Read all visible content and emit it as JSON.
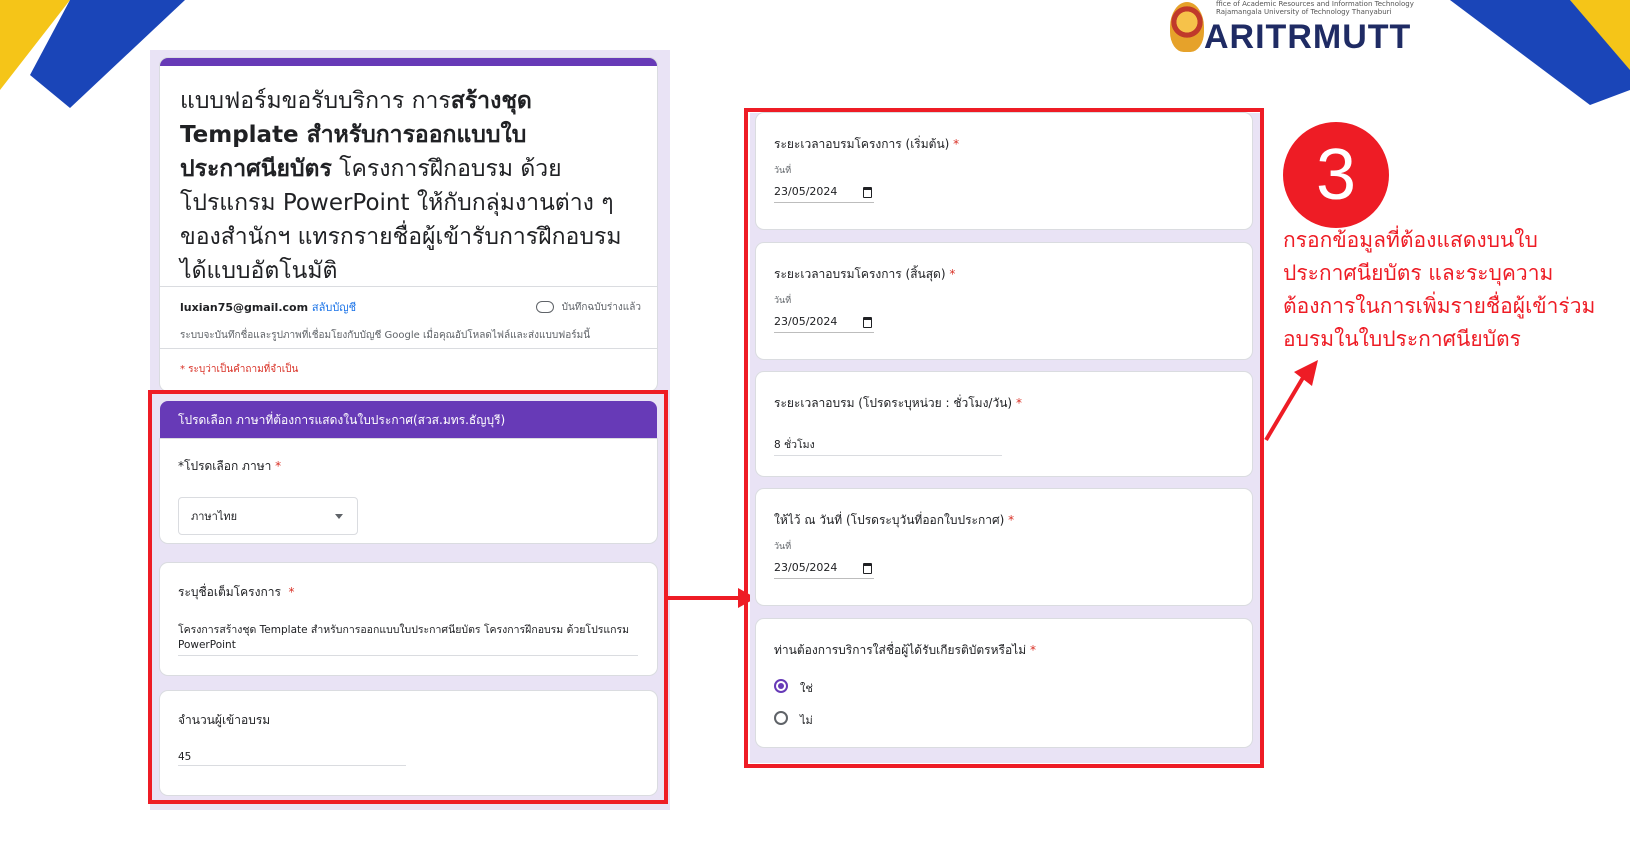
{
  "branding": {
    "logo_small_lines": [
      "ffice of Academic Resources and Information Technology",
      "Rajamangala University of Technology Thanyaburi"
    ],
    "logo_text": "ARITRMUTT"
  },
  "form_header": {
    "title_parts": [
      "แบบฟอร์มขอรับบริการ การ",
      "สร้างชุด Template สำหรับการออกแบบใบประกาศนียบัตร",
      " โครงการฝึกอบรม ด้วยโปรแกรม PowerPoint ให้กับกลุ่มงานต่าง ๆ ของสำนักฯ แทรกรายชื่อผู้เข้ารับการฝึกอบรม ได้แบบอัตโนมัติ"
    ],
    "email": "luxian75@gmail.com",
    "switch_account": "สลับบัญชี",
    "saved_status": "บันทึกฉบับร่างแล้ว",
    "note": "ระบบจะบันทึกชื่อและรูปภาพที่เชื่อมโยงกับบัญชี Google เมื่อคุณอัปโหลดไฟล์และส่งแบบฟอร์มนี้",
    "required_note": "* ระบุว่าเป็นคำถามที่จำเป็น"
  },
  "left_section": {
    "section_title": "โปรดเลือก ภาษาที่ต้องการแสดงในใบประกาศ(สวส.มทร.ธัญบุรี)",
    "language_label": "*โปรดเลือก ภาษา",
    "language_value": "ภาษาไทย",
    "project_label": "ระบุชื่อเต็มโครงการ",
    "project_value": "โครงการสร้างชุด Template สำหรับการออกแบบใบประกาศนียบัตร โครงการฝึกอบรม ด้วยโปรแกรม PowerPoint",
    "participants_label": "จำนวนผู้เข้าอบรม",
    "participants_value": "45"
  },
  "right_section": {
    "start_label": "ระยะเวลาอบรมโครงการ (เริ่มต้น)",
    "date_caption": "วันที่",
    "start_value": "23/05/2024",
    "end_label": "ระยะเวลาอบรมโครงการ (สิ้นสุด)",
    "end_value": "23/05/2024",
    "duration_label": "ระยะเวลาอบรม (โปรดระบุหน่วย : ชั่วโมง/วัน)",
    "duration_value": "8 ชั่วโมง",
    "issue_label": "ให้ไว้ ณ วันที่ (โปรดระบุวันที่ออกใบประกาศ)",
    "issue_value": "23/05/2024",
    "names_label": "ท่านต้องการบริการใส่ชื่อผู้ได้รับเกียรติบัตรหรือไม่",
    "option_yes": "ใช่",
    "option_no": "ไม่",
    "selected": "ใช่"
  },
  "annotation": {
    "step_number": "3",
    "text": "กรอกข้อมูลที่ต้องแสดงบนใบประกาศนียบัตร และระบุความต้องการในการเพิ่มรายชื่อผู้เข้าร่วมอบรมในใบประกาศนียบัตร"
  },
  "colors": {
    "accent_purple": "#673ab7",
    "highlight_red": "#ee1c25",
    "corner_yellow": "#f5c518",
    "corner_blue": "#1a45b8"
  }
}
